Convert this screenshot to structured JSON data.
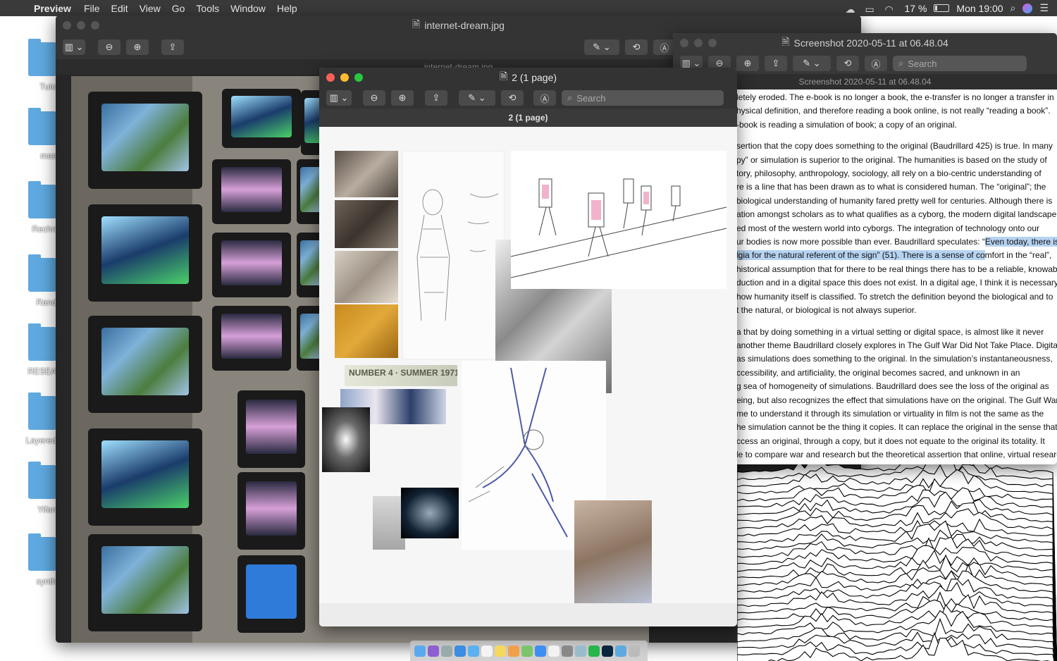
{
  "menubar": {
    "app": "Preview",
    "items": [
      "File",
      "Edit",
      "View",
      "Go",
      "Tools",
      "Window",
      "Help"
    ],
    "battery": "17 %",
    "clock": "Mon 19:00"
  },
  "desktop": {
    "folders": [
      "Tuto",
      "mas",
      "Rechn",
      "Rand",
      "RESEA",
      "Layered",
      "Yifan",
      "synth"
    ]
  },
  "win_back": {
    "title": "internet-dream.jpg",
    "subtitle": "internet-dream.jpg"
  },
  "win_mid": {
    "title": "2 (1 page)",
    "subtitle": "2 (1 page)",
    "search_placeholder": "Search",
    "magazine_text": "NUMBER 4 · SUMMER 1971"
  },
  "win_right": {
    "title": "Screenshot 2020-05-11 at 06.48.04",
    "subtitle": "Screenshot 2020-05-11 at 06.48.04",
    "search_placeholder": "Search",
    "paragraphs": [
      [
        "letely eroded. The e-book is no longer a book, the e-transfer is no longer a transfer in",
        "hysical definition, and therefore reading a book online, is not really “reading a book”.",
        "-book is reading a simulation of book; a copy of an original."
      ],
      [
        "sertion that the copy does something to the original (Baudrillard 425) is true. In many",
        "py” or simulation is superior to the original. The humanities is based on the study of",
        "tory, philosophy, anthropology, sociology, all rely on a bio-centric understanding of",
        "re is a line that has been drawn as to what is considered human. The “original”; the",
        "biological understanding of humanity fared pretty well for centuries. Although there is",
        "ation amongst scholars as to what qualifies as a cyborg, the modern digital landscape",
        "ed most of the western world into cyborgs. The integration of technology onto our"
      ],
      [
        "historical assumption that for there to be real things there has to be a reliable, knowable",
        "duction and in a digital space this does not exist. In a digital age, I think it is necessary",
        "how humanity itself is classified. To stretch the definition beyond the biological and to",
        "t the natural, or biological is not always superior."
      ],
      [
        "a that by doing something in a virtual setting or digital space, is almost like it never",
        "another theme Baudrillard closely explores in The Gulf War Did Not Take Place. Digital",
        " as simulations does something to the original. In the simulation’s instantaneousness,",
        "ccessibility, and artificiality, the original becomes sacred, and unknown in an",
        "g sea of homogeneity of simulations. Baudrillard does see the loss of the original as",
        "eing, but also recognizes the effect that simulations have on the original. The Gulf War",
        "me to understand it through its simulation or virtuality in film is not the same as the",
        "he simulation cannot be the thing it copies. It can replace the original in the sense that",
        "ccess an original, through a copy, but it does not equate to the original its totality. It",
        "le to compare war and research but the theoretical assertion that online, virtual research"
      ]
    ],
    "line_a_pre": "ur bodies is now more possible than ever. Baudrillard speculates: “",
    "line_a_hl": "Even today, there is a",
    "line_b_hl": "lgia for the natural referent of the sign” (51). There is a sense of co",
    "line_b_post": "mfort in the “real”,"
  },
  "colors": {
    "menubar": "#3a3a3a",
    "close": "#fe5f57",
    "minimize": "#febc2e",
    "zoom": "#28c840",
    "highlight": "#b6d3f2",
    "folder": "#5fa9e0"
  }
}
